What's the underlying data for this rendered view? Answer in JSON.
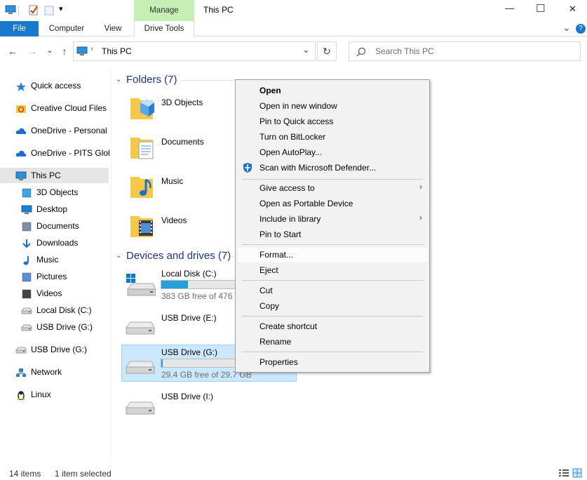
{
  "window": {
    "title": "This PC",
    "minimize": "—",
    "maximize": "☐",
    "close": "✕"
  },
  "ribbon": {
    "file": "File",
    "computer": "Computer",
    "view": "View",
    "manage": "Manage",
    "drive_tools": "Drive Tools",
    "collapse": "⌄",
    "help": "?"
  },
  "address": {
    "path": "This PC",
    "back": "←",
    "forward": "→",
    "recent": "⌄",
    "up": "↑",
    "dropdown": "⌄",
    "refresh": "↻",
    "search_placeholder": "Search This PC"
  },
  "nav": {
    "items": [
      {
        "label": "Quick access",
        "icon": "star-icon"
      },
      {
        "label": "Creative Cloud Files",
        "icon": "creative-cloud-icon"
      },
      {
        "label": "OneDrive - Personal",
        "icon": "cloud-icon"
      },
      {
        "label": "OneDrive - PITS Glob",
        "icon": "cloud-icon"
      },
      {
        "label": "This PC",
        "icon": "monitor-icon"
      },
      {
        "label": "3D Objects",
        "icon": "cube-icon"
      },
      {
        "label": "Desktop",
        "icon": "desktop-icon"
      },
      {
        "label": "Documents",
        "icon": "document-icon"
      },
      {
        "label": "Downloads",
        "icon": "download-icon"
      },
      {
        "label": "Music",
        "icon": "music-icon"
      },
      {
        "label": "Pictures",
        "icon": "picture-icon"
      },
      {
        "label": "Videos",
        "icon": "video-icon"
      },
      {
        "label": "Local Disk (C:)",
        "icon": "disk-icon"
      },
      {
        "label": "USB Drive (G:)",
        "icon": "usb-drive-icon"
      },
      {
        "label": "USB Drive (G:)",
        "icon": "usb-drive-icon"
      },
      {
        "label": "Network",
        "icon": "network-icon"
      },
      {
        "label": "Linux",
        "icon": "linux-icon"
      }
    ]
  },
  "folders": {
    "title": "Folders (7)",
    "items": [
      {
        "name": "3D Objects"
      },
      {
        "name": "Documents"
      },
      {
        "name": "Music"
      },
      {
        "name": "Videos"
      }
    ]
  },
  "drives": {
    "title": "Devices and drives (7)",
    "items": [
      {
        "name": "Local Disk (C:)",
        "free": "383 GB free of 476 GB",
        "used_fraction": 0.2
      },
      {
        "name": "USB Drive (E:)"
      },
      {
        "name": "USB Drive (G:)",
        "free": "29.4 GB free of 29.7 GB",
        "used_fraction": 0.01
      },
      {
        "name": "USB Drive (I:)"
      }
    ]
  },
  "context_menu": {
    "items": [
      "Open",
      "Open in new window",
      "Pin to Quick access",
      "Turn on BitLocker",
      "Open AutoPlay...",
      "Scan with Microsoft Defender...",
      "Give access to",
      "Open as Portable Device",
      "Include in library",
      "Pin to Start",
      "Format...",
      "Eject",
      "Cut",
      "Copy",
      "Create shortcut",
      "Rename",
      "Properties"
    ],
    "submenu_arrow": "›"
  },
  "status": {
    "count": "14 items",
    "selected": "1 item selected"
  },
  "colors": {
    "accent": "#1979ca",
    "manage_tab": "#c6efb3",
    "selection": "#cce8ff",
    "group_title": "#1e3287",
    "bar_fill": "#26a0da"
  }
}
